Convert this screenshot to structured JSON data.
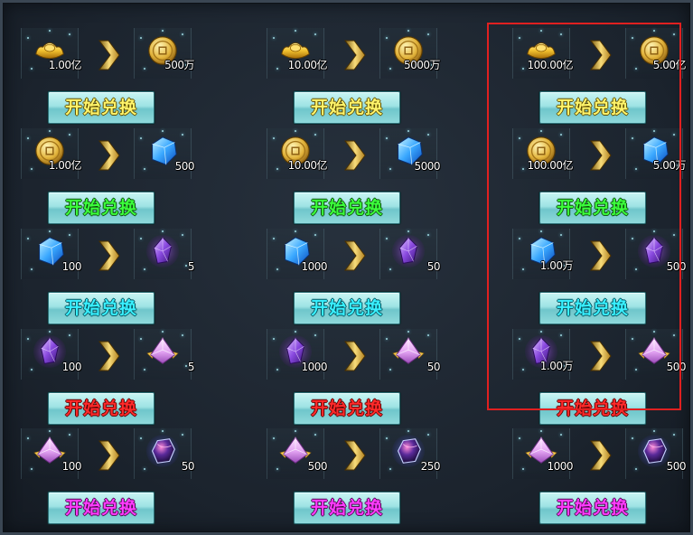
{
  "button_label": "开始兑换",
  "colors": {
    "yellow": "#fff46a",
    "green": "#3cff3c",
    "cyan": "#39f0ff",
    "red": "#ff2a2a",
    "purple": "#ff3cff",
    "highlight": "#e02020"
  },
  "rows": [
    {
      "button_color": "yellow",
      "cells": [
        {
          "from": {
            "icon": "gold-ingot-icon",
            "qty": "1.00亿"
          },
          "to": {
            "icon": "gold-coin-icon",
            "qty": "500万"
          }
        },
        {
          "from": {
            "icon": "gold-ingot-icon",
            "qty": "10.00亿"
          },
          "to": {
            "icon": "gold-coin-icon",
            "qty": "5000万"
          }
        },
        {
          "from": {
            "icon": "gold-ingot-icon",
            "qty": "100.00亿"
          },
          "to": {
            "icon": "gold-coin-icon",
            "qty": "5.00亿"
          }
        }
      ]
    },
    {
      "button_color": "green",
      "cells": [
        {
          "from": {
            "icon": "gold-coin-icon",
            "qty": "1.00亿"
          },
          "to": {
            "icon": "blue-crystal-icon",
            "qty": "500"
          }
        },
        {
          "from": {
            "icon": "gold-coin-icon",
            "qty": "10.00亿"
          },
          "to": {
            "icon": "blue-crystal-icon",
            "qty": "5000"
          }
        },
        {
          "from": {
            "icon": "gold-coin-icon",
            "qty": "100.00亿"
          },
          "to": {
            "icon": "blue-crystal-icon",
            "qty": "5.00万"
          }
        }
      ]
    },
    {
      "button_color": "cyan",
      "cells": [
        {
          "from": {
            "icon": "blue-crystal-icon",
            "qty": "100"
          },
          "to": {
            "icon": "purple-crystal-icon",
            "qty": "5"
          }
        },
        {
          "from": {
            "icon": "blue-crystal-icon",
            "qty": "1000"
          },
          "to": {
            "icon": "purple-crystal-icon",
            "qty": "50"
          }
        },
        {
          "from": {
            "icon": "blue-crystal-icon",
            "qty": "1.00万"
          },
          "to": {
            "icon": "purple-crystal-icon",
            "qty": "500"
          }
        }
      ]
    },
    {
      "button_color": "red",
      "cells": [
        {
          "from": {
            "icon": "purple-crystal-icon",
            "qty": "100"
          },
          "to": {
            "icon": "pink-gem-icon",
            "qty": "5"
          }
        },
        {
          "from": {
            "icon": "purple-crystal-icon",
            "qty": "1000"
          },
          "to": {
            "icon": "pink-gem-icon",
            "qty": "50"
          }
        },
        {
          "from": {
            "icon": "purple-crystal-icon",
            "qty": "1.00万"
          },
          "to": {
            "icon": "pink-gem-icon",
            "qty": "500"
          }
        }
      ]
    },
    {
      "button_color": "purple",
      "cells": [
        {
          "from": {
            "icon": "pink-gem-icon",
            "qty": "100"
          },
          "to": {
            "icon": "dark-orb-icon",
            "qty": "50"
          }
        },
        {
          "from": {
            "icon": "pink-gem-icon",
            "qty": "500"
          },
          "to": {
            "icon": "dark-orb-icon",
            "qty": "250"
          }
        },
        {
          "from": {
            "icon": "pink-gem-icon",
            "qty": "1000"
          },
          "to": {
            "icon": "dark-orb-icon",
            "qty": "500"
          }
        }
      ]
    }
  ]
}
